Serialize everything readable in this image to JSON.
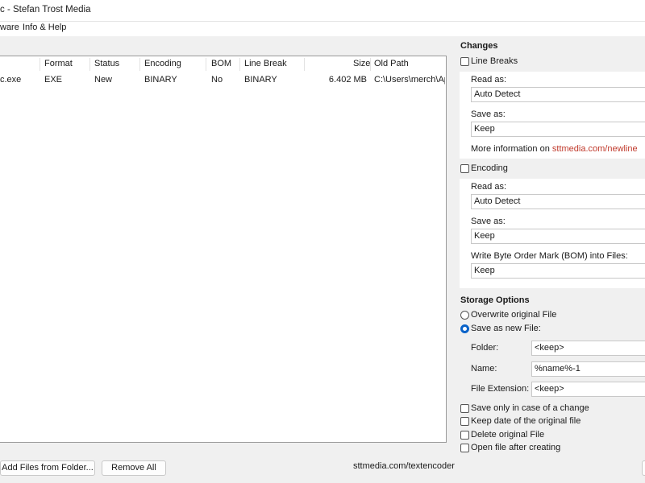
{
  "window": {
    "title": "c - Stefan Trost Media"
  },
  "menu": {
    "items": [
      "ware",
      "Info & Help"
    ]
  },
  "file_list": {
    "columns": [
      "Format",
      "Status",
      "Encoding",
      "BOM",
      "Line Break",
      "Size",
      "Old Path"
    ],
    "rows": [
      {
        "name": "c.exe",
        "format": "EXE",
        "status": "New",
        "encoding": "BINARY",
        "bom": "No",
        "line_break": "BINARY",
        "size": "6.402 MB",
        "old_path": "C:\\Users\\merch\\App"
      }
    ]
  },
  "bottom": {
    "add_folder": "Add Files from Folder...",
    "remove_all": "Remove All",
    "website": "sttmedia.com/textencoder"
  },
  "changes": {
    "title": "Changes",
    "line_breaks": {
      "label": "Line Breaks",
      "read_as_label": "Read as:",
      "read_as_value": "Auto Detect",
      "save_as_label": "Save as:",
      "save_as_value": "Keep",
      "more_info_prefix": "More information on",
      "more_info_link": "sttmedia.com/newline"
    },
    "encoding": {
      "label": "Encoding",
      "read_as_label": "Read as:",
      "read_as_value": "Auto Detect",
      "save_as_label": "Save as:",
      "save_as_value": "Keep",
      "bom_label": "Write Byte Order Mark (BOM) into Files:",
      "bom_value": "Keep"
    }
  },
  "storage": {
    "title": "Storage Options",
    "overwrite": "Overwrite original File",
    "save_new": "Save as new File:",
    "folder_label": "Folder:",
    "folder_value": "<keep>",
    "name_label": "Name:",
    "name_value": "%name%-1",
    "ext_label": "File Extension:",
    "ext_value": "<keep>",
    "opt_change": "Save only in case of a change",
    "opt_date": "Keep date of the original file",
    "opt_delete": "Delete original File",
    "opt_open": "Open file after creating"
  },
  "colors": {
    "accent": "#0a63c9",
    "link": "#c0392b"
  }
}
